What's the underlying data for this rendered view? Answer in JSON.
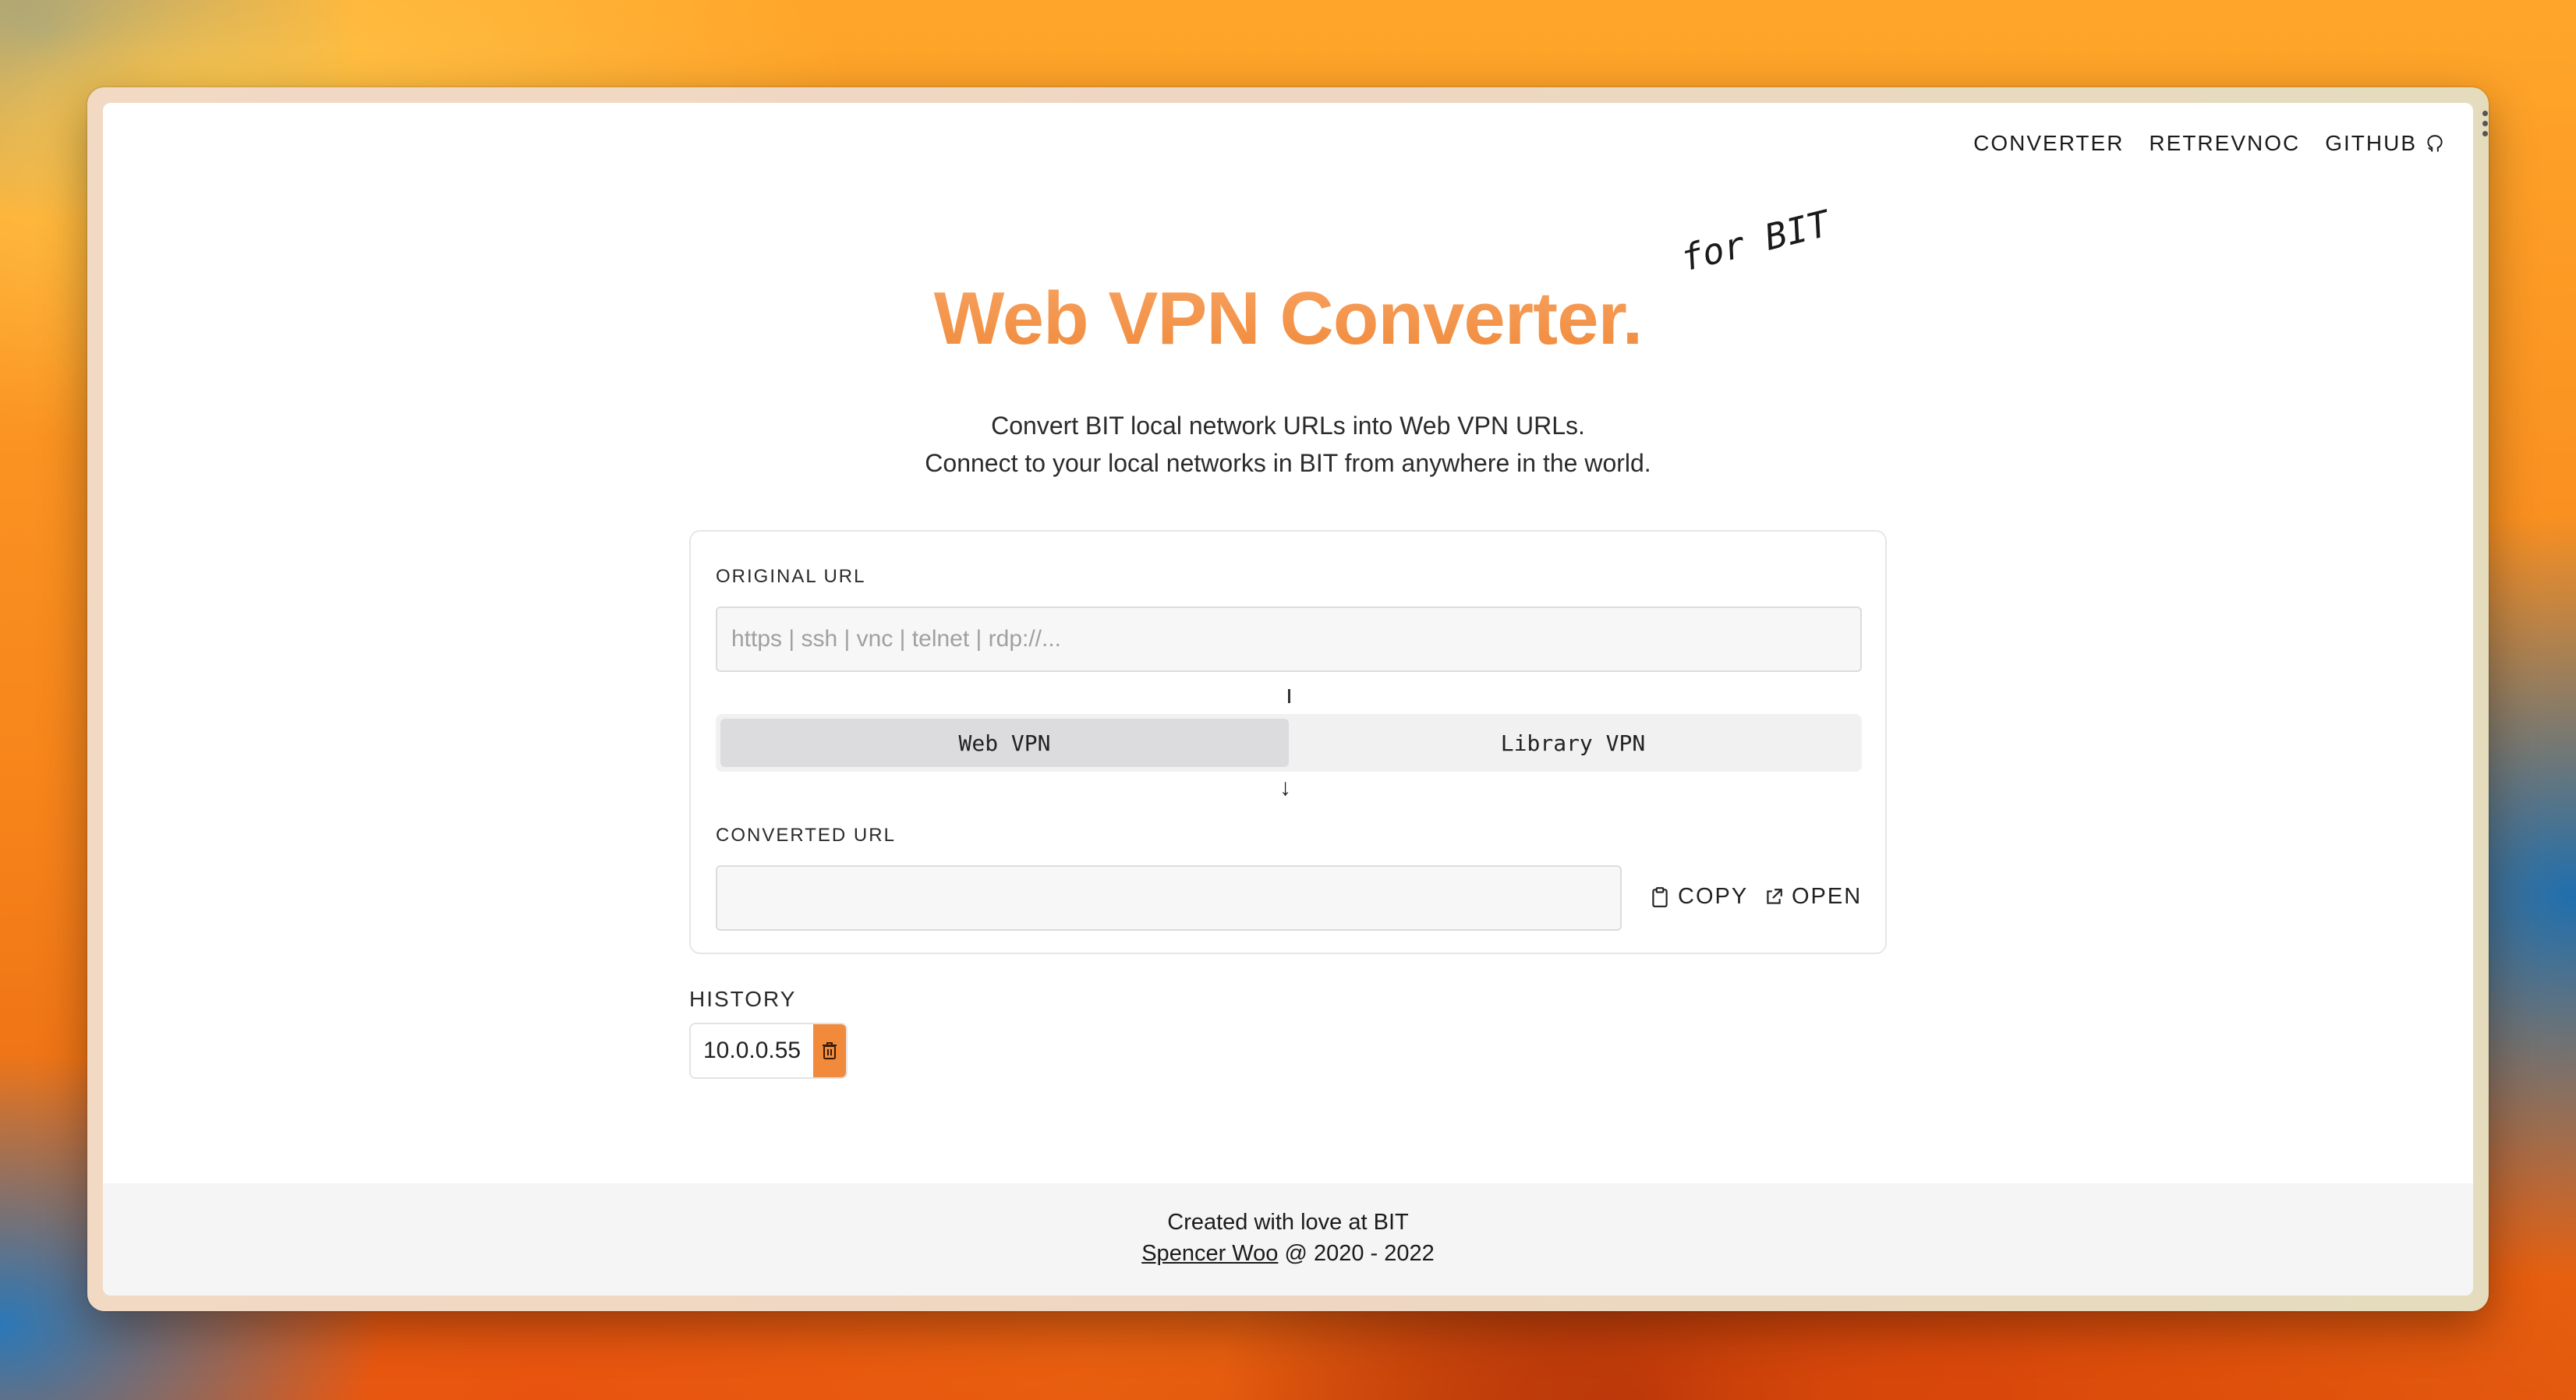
{
  "nav": {
    "items": [
      {
        "label": "CONVERTER"
      },
      {
        "label": "RETREVNOC"
      },
      {
        "label": "GITHUB",
        "icon": "github-icon"
      }
    ]
  },
  "hero": {
    "title": "Web VPN Converter.",
    "badge": "for BIT",
    "subtitle_line1": "Convert BIT local network URLs into Web VPN URLs.",
    "subtitle_line2": "Connect to your local networks in BIT from anywhere in the world."
  },
  "converter": {
    "original_label": "ORIGINAL URL",
    "original_placeholder": "https | ssh | vnc | telnet | rdp://...",
    "original_value": "",
    "modes": [
      {
        "label": "Web VPN",
        "selected": true
      },
      {
        "label": "Library VPN",
        "selected": false
      }
    ],
    "converted_label": "CONVERTED URL",
    "converted_value": "",
    "copy_label": "COPY",
    "open_label": "OPEN"
  },
  "history": {
    "label": "HISTORY",
    "items": [
      {
        "value": "10.0.0.55"
      }
    ]
  },
  "footer": {
    "line1": "Created with love at BIT",
    "author": "Spencer Woo",
    "years": "@ 2020 - 2022"
  },
  "colors": {
    "accent": "#f28a3c",
    "title_gradient_top": "#f7a261",
    "title_gradient_bottom": "#f08a3a"
  }
}
